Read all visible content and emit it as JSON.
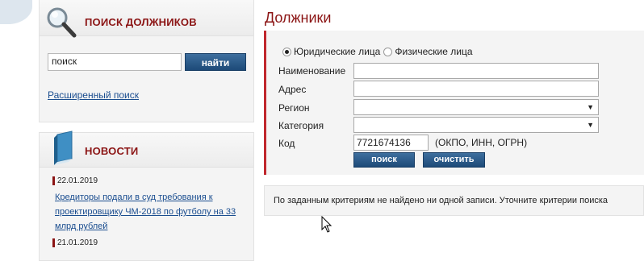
{
  "left": {
    "search_panel": {
      "title": "ПОИСК ДОЛЖНИКОВ",
      "icon": "magnifier-icon",
      "input_value": "поиск",
      "button_label": "найти",
      "advanced_link": "Расширенный поиск"
    },
    "news_panel": {
      "title": "НОВОСТИ",
      "icon": "book-icon",
      "items": [
        {
          "date": "22.01.2019",
          "title": "Кредиторы подали в суд требования к проектировщику ЧМ-2018 по футболу на 33 млрд рублей"
        },
        {
          "date": "21.01.2019",
          "title": ""
        }
      ]
    }
  },
  "main": {
    "title": "Должники",
    "radio_options": [
      {
        "label": "Юридические лица",
        "checked": true
      },
      {
        "label": "Физические лица",
        "checked": false
      }
    ],
    "fields": [
      {
        "label": "Наименование",
        "value": ""
      },
      {
        "label": "Адрес",
        "value": ""
      },
      {
        "label": "Регион",
        "value": ""
      },
      {
        "label": "Категория",
        "value": ""
      },
      {
        "label": "Код",
        "value": "7721674136"
      }
    ],
    "code_hint": "(ОКПО, ИНН, ОГРН)",
    "find_button": "поиск",
    "clear_button": "очистить",
    "no_results_message": "По заданным критериям не найдено ни одной записи. Уточните критерии поиска"
  },
  "colors": {
    "accent_red": "#8b1414",
    "button_blue": "#1d4a78",
    "link_blue": "#1a4d8f",
    "panel_bg": "#f4f4f4"
  }
}
